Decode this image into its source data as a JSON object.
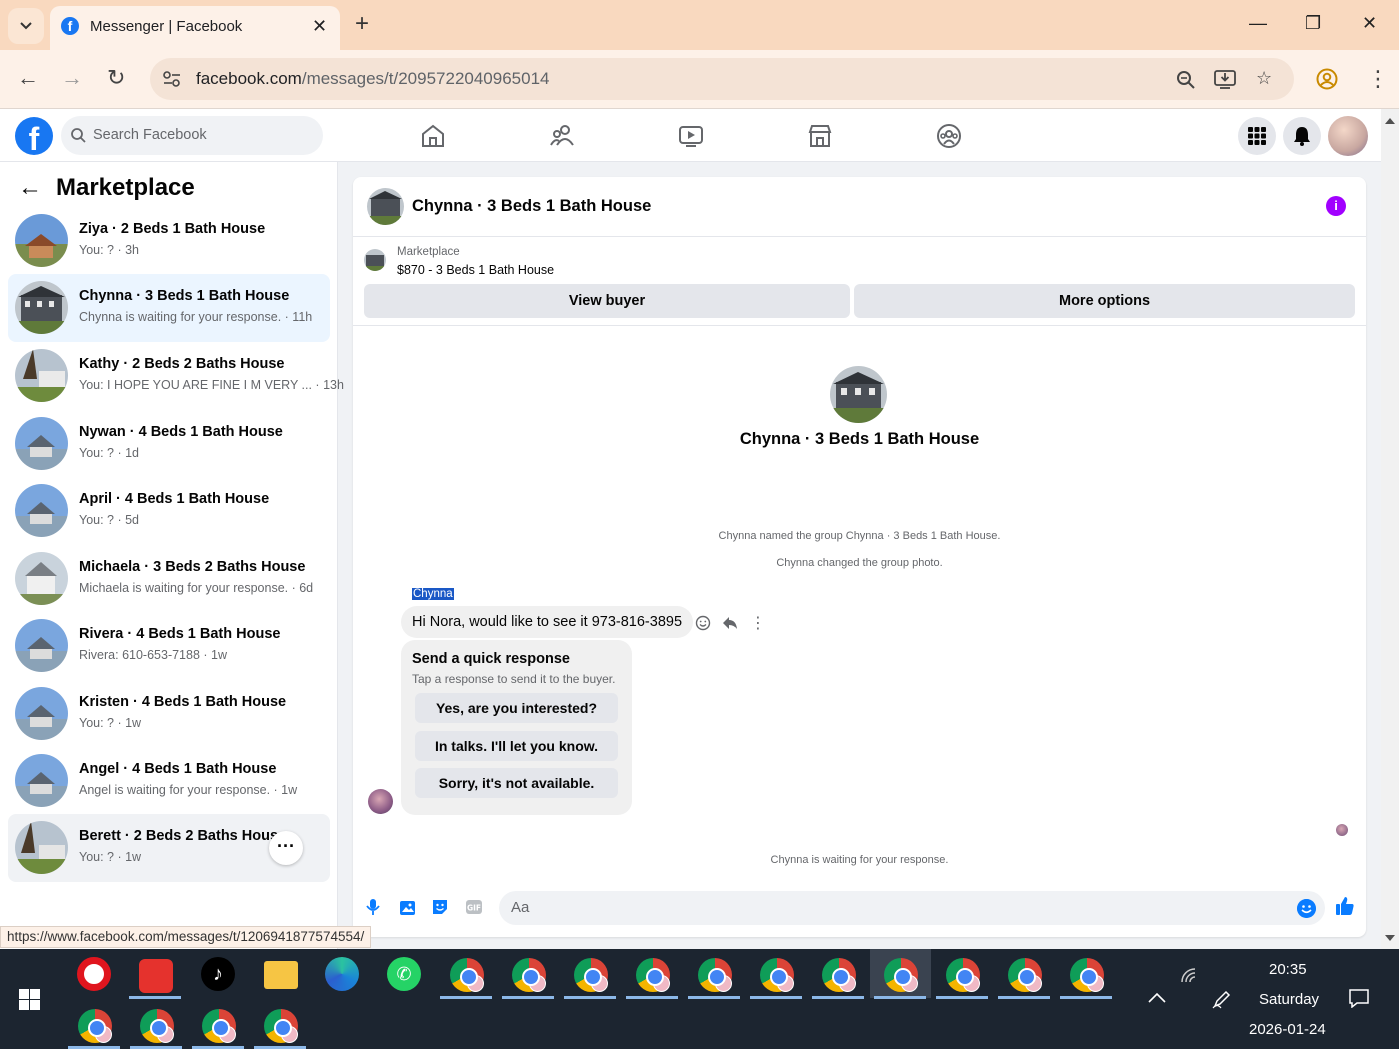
{
  "browser": {
    "tab_title": "Messenger | Facebook",
    "url_host": "facebook.com",
    "url_path": "/messages/t/2095722040965014",
    "status_url": "https://www.facebook.com/messages/t/1206941877574554/"
  },
  "fb": {
    "search_placeholder": "Search Facebook"
  },
  "sidebar": {
    "title": "Marketplace",
    "conversations": [
      {
        "name": "Ziya · 2 Beds 1 Bath House",
        "snippet": "You: ? · 3h"
      },
      {
        "name": "Chynna · 3 Beds 1 Bath House",
        "snippet": "Chynna is waiting for your response. · 11h"
      },
      {
        "name": "Kathy · 2 Beds 2 Baths House",
        "snippet": "You: I HOPE YOU ARE FINE I M VERY ... · 13h"
      },
      {
        "name": "Nywan · 4 Beds 1 Bath House",
        "snippet": "You: ? · 1d"
      },
      {
        "name": "April · 4 Beds 1 Bath House",
        "snippet": "You: ? · 5d"
      },
      {
        "name": "Michaela · 3 Beds 2 Baths House",
        "snippet": "Michaela is waiting for your response. · 6d"
      },
      {
        "name": "Rivera · 4 Beds 1 Bath House",
        "snippet": "Rivera: 610-653-7188 · 1w"
      },
      {
        "name": "Kristen · 4 Beds 1 Bath House",
        "snippet": "You: ? · 1w"
      },
      {
        "name": "Angel · 4 Beds 1 Bath House",
        "snippet": "Angel is waiting for your response. · 1w"
      },
      {
        "name": "Berett · 2 Beds 2 Baths House",
        "snippet": "You: ? · 1w"
      }
    ]
  },
  "chat": {
    "title": "Chynna · 3 Beds 1 Bath House",
    "listing_label": "Marketplace",
    "listing_price": "$870 - 3 Beds 1 Bath House",
    "view_buyer": "View buyer",
    "more_options": "More options",
    "intro_name": "Chynna · 3 Beds 1 Bath House",
    "system_1": "Chynna named the group Chynna · 3 Beds 1 Bath House.",
    "system_2": "Chynna changed the group photo.",
    "sender": "Chynna",
    "message": "Hi Nora, would like to see it 973-816-3895",
    "quick_title": "Send a quick response",
    "quick_sub": "Tap a response to send it to the buyer.",
    "quick_1": "Yes, are you interested?",
    "quick_2": "In talks. I'll let you know.",
    "quick_3": "Sorry, it's not available.",
    "waiting": "Chynna is waiting for your response.",
    "composer_placeholder": "Aa"
  },
  "taskbar": {
    "time": "20:35",
    "day": "Saturday",
    "date": "2026-01-24"
  }
}
